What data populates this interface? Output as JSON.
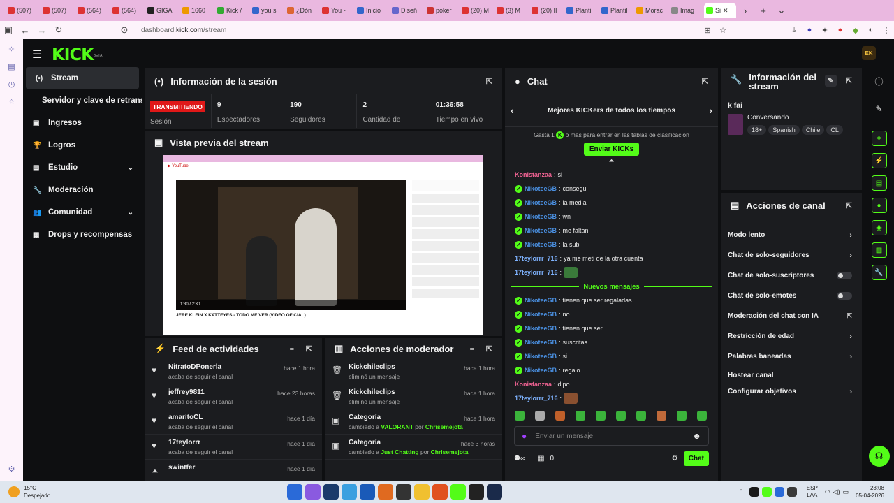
{
  "browser": {
    "tabs": [
      "(507)",
      "(507)",
      "(564)",
      "(564)",
      "GIGA",
      "1660",
      "Kick /",
      "you s",
      "¿Dón",
      "You -",
      "Inicio",
      "Diseñ",
      "poker",
      "(20) M",
      "(3) M",
      "(20) II",
      "Plantil",
      "Plantil",
      "Morac",
      "Imag",
      "Si"
    ],
    "url_prefix": "dashboard.",
    "url_domain": "kick.com",
    "url_path": "/stream"
  },
  "kick": {
    "logo": "KICK",
    "logo_beta": "BETA",
    "sidebar": [
      {
        "label": "Stream",
        "icon": "signal-icon",
        "active": true
      },
      {
        "label": "Servidor y clave de retransm",
        "icon": "",
        "active": false
      },
      {
        "label": "Ingresos",
        "icon": "dollar-icon"
      },
      {
        "label": "Logros",
        "icon": "trophy-icon"
      },
      {
        "label": "Estudio",
        "icon": "studio-icon",
        "chev": "⌄"
      },
      {
        "label": "Moderación",
        "icon": "wrench-icon"
      },
      {
        "label": "Comunidad",
        "icon": "users-icon",
        "chev": "⌄"
      },
      {
        "label": "Drops y recompensas",
        "icon": "gift-icon"
      }
    ],
    "session": {
      "title": "Información de la sesión",
      "live_badge": "TRANSMITIENDO",
      "session_label": "Sesión",
      "stats": [
        {
          "value": "9",
          "label": "Espectadores"
        },
        {
          "value": "190",
          "label": "Seguidores"
        },
        {
          "value": "2",
          "label": "Cantidad de"
        },
        {
          "value": "01:36:58",
          "label": "Tiempo en vivo"
        }
      ]
    },
    "preview": {
      "title": "Vista previa del stream",
      "video_title": "JERE KLEIN X KATTEYES - TODO ME VER (VIDEO OFICIAL)",
      "video_time": "1:30 / 2:30"
    },
    "feed": {
      "title": "Feed de actividades",
      "items": [
        {
          "name": "NitratoDPonerla",
          "desc": "acaba de seguir el canal",
          "time": "hace 1 hora"
        },
        {
          "name": "jeffrey9811",
          "desc": "acaba de seguir el canal",
          "time": "hace 23 horas"
        },
        {
          "name": "amaritoCL",
          "desc": "acaba de seguir el canal",
          "time": "hace 1 día"
        },
        {
          "name": "17teylorrr",
          "desc": "acaba de seguir el canal",
          "time": "hace 1 día"
        },
        {
          "name": "swintfer",
          "desc": "",
          "time": "hace 1 día"
        }
      ]
    },
    "mod": {
      "title": "Acciones de moderador",
      "items": [
        {
          "name": "Kickchileclips",
          "desc": "eliminó un mensaje",
          "time": "hace 1 hora"
        },
        {
          "name": "Kickchileclips",
          "desc": "eliminó un mensaje",
          "time": "hace 1 hora"
        },
        {
          "name": "Categoría",
          "desc_pre": "cambiado a ",
          "cat": "VALORANT",
          "desc_mid": " por ",
          "user": "Chrisemejota",
          "time": "hace 1 hora"
        },
        {
          "name": "Categoría",
          "desc_pre": "cambiado a ",
          "cat": "Just Chatting",
          "desc_mid": " por ",
          "user": "Chrisemejota",
          "time": "hace 3 horas"
        }
      ]
    },
    "chat": {
      "title": "Chat",
      "leaderboard": "Mejores KICKers de todos los tiempos",
      "gift_pre": "Gasta 1",
      "gift_post": "o más para entrar en las tablas de clasificación",
      "send_kicks": "Enviar KICKs",
      "new_messages": "Nuevos mensajes",
      "messages_before": [
        {
          "user": "Konistanzaa",
          "color": "#f06292",
          "badge": false,
          "text": "si"
        },
        {
          "user": "NikoteeGB",
          "color": "#4a90e2",
          "badge": true,
          "text": "consegui"
        },
        {
          "user": "NikoteeGB",
          "color": "#4a90e2",
          "badge": true,
          "text": "la media"
        },
        {
          "user": "NikoteeGB",
          "color": "#4a90e2",
          "badge": true,
          "text": "wn"
        },
        {
          "user": "NikoteeGB",
          "color": "#4a90e2",
          "badge": true,
          "text": "me faltan"
        },
        {
          "user": "NikoteeGB",
          "color": "#4a90e2",
          "badge": true,
          "text": "la sub"
        },
        {
          "user": "17teylorrr_716",
          "color": "#7fb3ff",
          "badge": false,
          "text": "ya me meti de la otra cuenta"
        },
        {
          "user": "17teylorrr_716",
          "color": "#7fb3ff",
          "badge": false,
          "text": ""
        }
      ],
      "messages_after": [
        {
          "user": "NikoteeGB",
          "color": "#4a90e2",
          "badge": true,
          "text": "tienen que ser regaladas"
        },
        {
          "user": "NikoteeGB",
          "color": "#4a90e2",
          "badge": true,
          "text": "no"
        },
        {
          "user": "NikoteeGB",
          "color": "#4a90e2",
          "badge": true,
          "text": "tienen que ser"
        },
        {
          "user": "NikoteeGB",
          "color": "#4a90e2",
          "badge": true,
          "text": "suscritas"
        },
        {
          "user": "NikoteeGB",
          "color": "#4a90e2",
          "badge": true,
          "text": "si"
        },
        {
          "user": "NikoteeGB",
          "color": "#4a90e2",
          "badge": true,
          "text": "regalo"
        },
        {
          "user": "Konistanzaa",
          "color": "#f06292",
          "badge": false,
          "text": "dipo"
        },
        {
          "user": "17teylorrr_716",
          "color": "#7fb3ff",
          "badge": false,
          "text": ""
        }
      ],
      "input_placeholder": "Enviar un mensaje",
      "count": "0",
      "send": "Chat"
    },
    "stream_info": {
      "title": "Información del stream",
      "stream_title": "k fai",
      "category": "Conversando",
      "tags": [
        "18+",
        "Spanish",
        "Chile",
        "CL"
      ]
    },
    "channel_actions": {
      "title": "Acciones de canal",
      "items": [
        {
          "label": "Modo lento",
          "ctl": "arrow"
        },
        {
          "label": "Chat de solo-seguidores",
          "ctl": "arrow"
        },
        {
          "label": "Chat de solo-suscriptores",
          "ctl": "toggle"
        },
        {
          "label": "Chat de solo-emotes",
          "ctl": "toggle"
        },
        {
          "label": "Moderación del chat con IA",
          "ctl": "ext"
        },
        {
          "label": "Restricción de edad",
          "ctl": "arrow"
        },
        {
          "label": "Palabras baneadas",
          "ctl": "arrow"
        },
        {
          "label": "Hostear canal",
          "ctl": "none"
        },
        {
          "label": "Configurar objetivos",
          "ctl": "arrow"
        }
      ]
    }
  },
  "taskbar": {
    "temp": "15°C",
    "weather": "Despejado",
    "lang1": "ESP",
    "lang2": "LAA",
    "time": "23:08",
    "date": "05-04-2026"
  },
  "colors": {
    "accent": "#53fc18",
    "live": "#e01818"
  }
}
